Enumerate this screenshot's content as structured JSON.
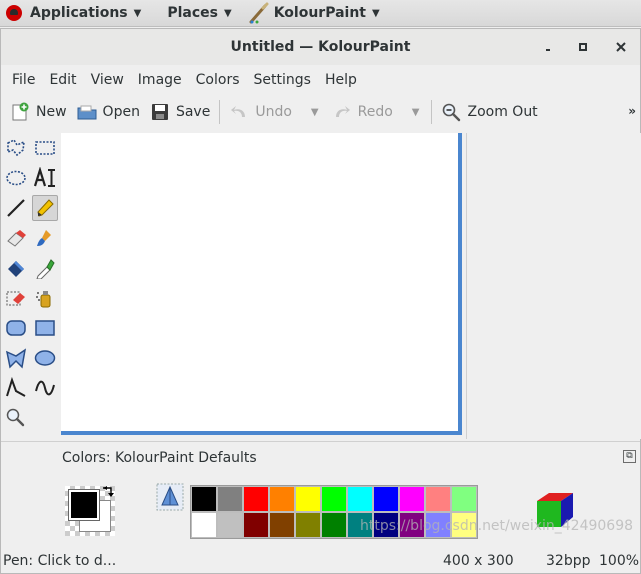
{
  "top_panel": {
    "applications_label": "Applications",
    "places_label": "Places",
    "active_app_label": "KolourPaint"
  },
  "window": {
    "title": "Untitled — KolourPaint"
  },
  "menu": [
    "File",
    "Edit",
    "View",
    "Image",
    "Colors",
    "Settings",
    "Help"
  ],
  "toolbar": {
    "new_label": "New",
    "open_label": "Open",
    "save_label": "Save",
    "undo_label": "Undo",
    "redo_label": "Redo",
    "zoom_out_label": "Zoom Out",
    "overflow_label": "»"
  },
  "colors": {
    "label": "Colors: KolourPaint Defaults",
    "foreground": "#000000",
    "background": "#ffffff",
    "palette_row1": [
      "#000000",
      "#808080",
      "#ff0000",
      "#ff8000",
      "#ffff00",
      "#00ff00",
      "#00ffff",
      "#0000ff",
      "#ff00ff",
      "#ff8080",
      "#80ff80"
    ],
    "palette_row2": [
      "#ffffff",
      "#c0c0c0",
      "#800000",
      "#804000",
      "#808000",
      "#008000",
      "#008080",
      "#000080",
      "#800080",
      "#8080ff",
      "#ffff80"
    ]
  },
  "status": {
    "message": "Pen: Click to d...",
    "dimensions": "400 x 300",
    "depth": "32bpp",
    "zoom": "100%"
  },
  "watermark": "https://blog.csdn.net/weixin_42490698",
  "accent_color": "#4a86cf"
}
